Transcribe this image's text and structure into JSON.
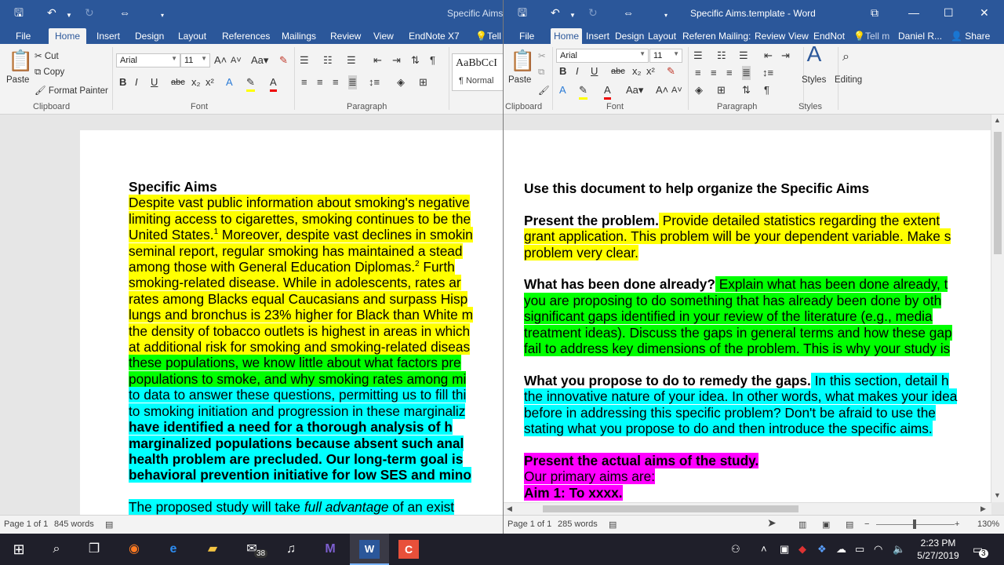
{
  "left_window": {
    "title": "Specific Aims",
    "tabs": [
      "File",
      "Home",
      "Insert",
      "Design",
      "Layout",
      "References",
      "Mailings",
      "Review",
      "View",
      "EndNote X7",
      "Tell"
    ],
    "clipboard": {
      "paste": "Paste",
      "cut": "Cut",
      "copy": "Copy",
      "format_painter": "Format Painter",
      "group": "Clipboard"
    },
    "font": {
      "name": "Arial",
      "size": "11",
      "group": "Font"
    },
    "paragraph_group": "Paragraph",
    "styles": {
      "preview": "AaBbCcI",
      "normal": "¶ Normal"
    },
    "document": {
      "title": "Specific Aims",
      "lines": [
        "Despite vast public information about smoking's negative",
        "limiting access to cigarettes, smoking continues to be the",
        "United States.",
        " Moreover, despite vast declines in smokin",
        "seminal report, regular smoking has maintained a stead",
        "among those with General Education Diplomas.",
        " Furth",
        "smoking-related disease. While in adolescents, rates ar",
        "rates among Blacks equal Caucasians and surpass Hisp",
        "lungs and bronchus is 23% higher for Black than White m",
        "the density of tobacco outlets is highest in areas in which",
        "at additional risk for smoking and smoking-related diseas",
        "these populations, we know little about what factors pre",
        "populations to smoke, and why smoking rates among mi",
        "to data to answer these questions, permitting us to fill thi",
        "to smoking initiation and progression in these marginaliz",
        "have identified a need for a thorough analysis of h",
        "marginalized populations because absent such anal",
        "health problem are precluded. Our long-term goal is",
        "behavioral prevention initiative for low SES and mino",
        "The proposed study will take ",
        "full advantage",
        " of an exist"
      ],
      "superscripts": [
        "1",
        "2"
      ]
    },
    "status": {
      "page": "Page 1 of 1",
      "words": "845 words"
    }
  },
  "right_window": {
    "title": "Specific Aims.template - Word",
    "tabs": [
      "File",
      "Home",
      "Insert",
      "Design",
      "Layout",
      "Referen",
      "Mailing:",
      "Review",
      "View",
      "EndNot",
      "Tell m",
      "Daniel R...",
      "Share"
    ],
    "clipboard": {
      "paste": "Paste",
      "group": "Clipboard"
    },
    "font": {
      "name": "Arial",
      "size": "11",
      "group": "Font"
    },
    "paragraph_group": "Paragraph",
    "styles_label": "Styles",
    "styles_group": "Styles",
    "editing_label": "Editing",
    "document": {
      "heading": "Use this document to help organize the Specific Aims",
      "p1_label": "Present the problem.",
      "p1_lines": [
        " Provide detailed statistics regarding the extent",
        "grant application. This problem will be your dependent variable. Make s",
        "problem very clear."
      ],
      "p2_label": "What has been done already?",
      "p2_lines": [
        " Explain what has been done already, t",
        "you are proposing to do something that has already been done by oth",
        "significant gaps identified in your review of the literature (e.g., media",
        "treatment ideas). Discuss the gaps in general terms and how these gap",
        "fail to address key dimensions of the problem. This is why your study is"
      ],
      "p3_label": "What you propose to do to remedy the gaps.",
      "p3_lines": [
        " In this section, detail h",
        "the innovative nature of your idea. In other words, what makes your idea",
        "before in addressing this specific problem? Don't be afraid to use the",
        "stating what you propose to do and then introduce the specific aims."
      ],
      "aims_heading": "Present the actual aims of the study.",
      "aims_intro": "Our primary aims are:",
      "aim1": "Aim 1: To xxxx."
    },
    "status": {
      "page": "Page 1 of 1",
      "words": "285 words",
      "zoom": "130%"
    }
  },
  "taskbar": {
    "mail_badge": "38",
    "notif_badge": "3",
    "time": "2:23 PM",
    "date": "5/27/2019"
  },
  "colors": {
    "word_blue": "#2b579a",
    "highlight_yellow": "#ffff00",
    "highlight_green": "#00ff00",
    "highlight_cyan": "#00ffff",
    "highlight_magenta": "#ff00ff"
  }
}
